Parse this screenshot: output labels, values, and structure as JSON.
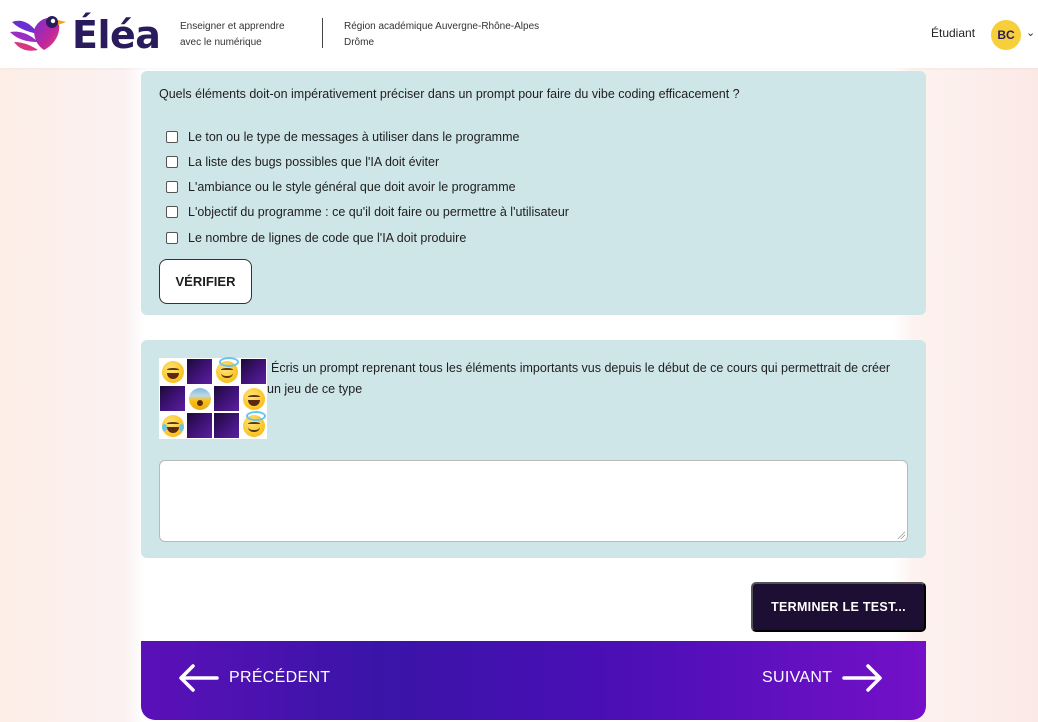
{
  "header": {
    "logo_text": "Éléa",
    "tagline_line1": "Enseigner et apprendre",
    "tagline_line2": "avec le numérique",
    "region_line1": "Région académique Auvergne-Rhône-Alpes",
    "region_line2": "Drôme",
    "user_role": "Étudiant",
    "avatar_initials": "BC",
    "avatar_color": "#f7cf3a"
  },
  "question": {
    "text": "Quels éléments doit-on impérativement préciser dans un prompt pour faire du vibe coding efficacement ?",
    "options": [
      {
        "label": "Le ton ou le type de messages à utiliser dans le programme",
        "checked": false
      },
      {
        "label": "La liste des bugs possibles que l'IA doit éviter",
        "checked": false
      },
      {
        "label": "L'ambiance ou le style général que doit avoir le programme",
        "checked": false
      },
      {
        "label": "L'objectif du programme : ce qu'il doit faire ou permettre à l'utilisateur",
        "checked": false
      },
      {
        "label": "Le nombre de lignes de code que l'IA doit produire",
        "checked": false
      }
    ],
    "verify_label": "VÉRIFIER"
  },
  "prompt_task": {
    "text": "Écris un prompt reprenant tous les éléments importants vus depuis le début de ce cours qui permettrait de créer un jeu de ce type",
    "answer_value": "",
    "grid_tiles": [
      "laughing-emoji",
      "hidden-tile",
      "halo-emoji",
      "hidden-tile",
      "hidden-tile",
      "fear-emoji",
      "hidden-tile",
      "laughing-emoji",
      "tears-of-joy-emoji",
      "hidden-tile",
      "hidden-tile",
      "halo-emoji"
    ]
  },
  "finish_label": "TERMINER LE TEST...",
  "navigation": {
    "prev_label": "PRÉCÉDENT",
    "next_label": "SUIVANT"
  },
  "colors": {
    "card_bg": "#cfe6e9",
    "finish_bg": "#1d0e33",
    "nav_gradient_start": "#5b10b8",
    "nav_gradient_end": "#7410c8",
    "brand_dark": "#2a1c5c"
  }
}
